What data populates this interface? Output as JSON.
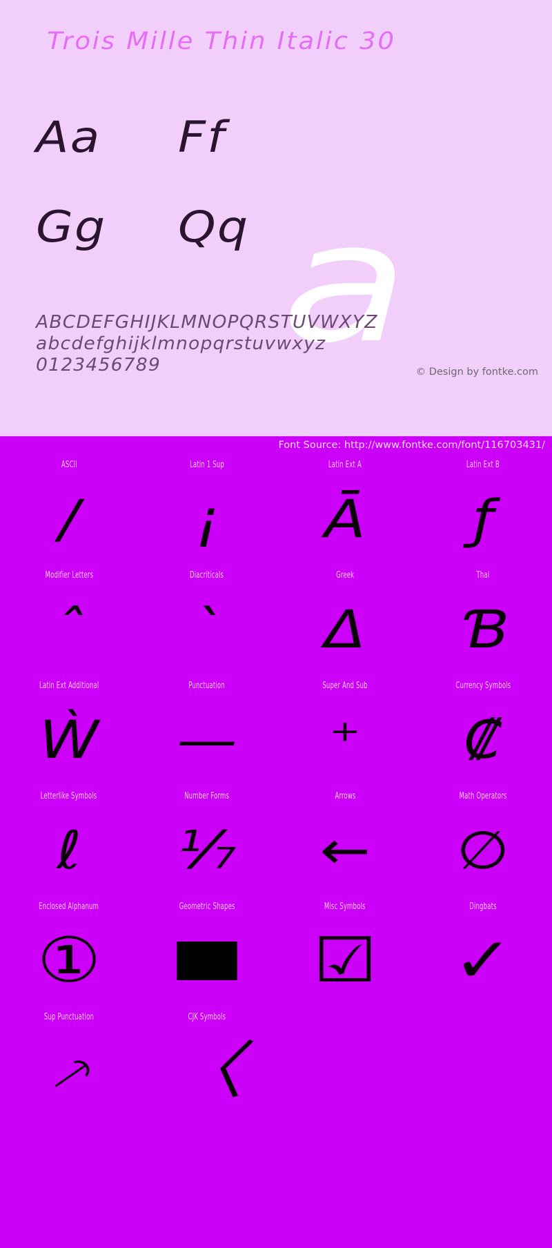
{
  "header": {
    "title": "Trois Mille Thin Italic 30"
  },
  "specimen": {
    "glyph_pairs": [
      "Aa",
      "Ff",
      "Gg",
      "Qq"
    ],
    "watermark_glyph": "a",
    "alphabet_lines": [
      "ABCDEFGHIJKLMNOPQRSTUVWXYZ",
      "abcdefghijklmnopqrstuvwxyz",
      "0123456789"
    ],
    "copyright": "© Design by fontke.com"
  },
  "footer": {
    "font_source": "Font Source: http://www.fontke.com/font/116703431/"
  },
  "unicode_blocks": {
    "rows": [
      [
        {
          "label": "ASCII",
          "sample": "/"
        },
        {
          "label": "Latin 1 Sup",
          "sample": "¡"
        },
        {
          "label": "Latin Ext A",
          "sample": "Ā"
        },
        {
          "label": "Latin Ext B",
          "sample": "ƒ"
        }
      ],
      [
        {
          "label": "Modifier Letters",
          "sample": "ˆ"
        },
        {
          "label": "Diacriticals",
          "sample": "`"
        },
        {
          "label": "Greek",
          "sample": "Δ"
        },
        {
          "label": "Thai",
          "sample": "Ɓ"
        }
      ],
      [
        {
          "label": "Latin Ext Additional",
          "sample": "Ẁ"
        },
        {
          "label": "Punctuation",
          "sample": "—"
        },
        {
          "label": "Super And Sub",
          "sample": "⁺"
        },
        {
          "label": "Currency Symbols",
          "sample": "₡"
        }
      ],
      [
        {
          "label": "Letterlike Symbols",
          "sample": "ℓ"
        },
        {
          "label": "Number Forms",
          "sample": "⅐"
        },
        {
          "label": "Arrows",
          "sample": "←"
        },
        {
          "label": "Math Operators",
          "sample": "∅"
        }
      ],
      [
        {
          "label": "Enclosed Alphanum",
          "sample": "①"
        },
        {
          "label": "Geometric Shapes",
          "sample": "■"
        },
        {
          "label": "Misc Symbols",
          "sample": "☑"
        },
        {
          "label": "Dingbats",
          "sample": "✓"
        }
      ],
      [
        {
          "label": "Sup Punctuation",
          "sample": "⸕"
        },
        {
          "label": "CJK Symbols",
          "sample": "〈"
        },
        {
          "label": "",
          "sample": ""
        },
        {
          "label": "",
          "sample": ""
        }
      ]
    ]
  },
  "colors": {
    "top_background": "#f2cffb",
    "bottom_background": "#cc00f9",
    "title_color": "#e56ef7",
    "glyph_color": "#2b1430",
    "alphabet_color": "#6d4a74",
    "watermark_color": "#ffffff",
    "block_label_color": "#fbc9ff"
  }
}
